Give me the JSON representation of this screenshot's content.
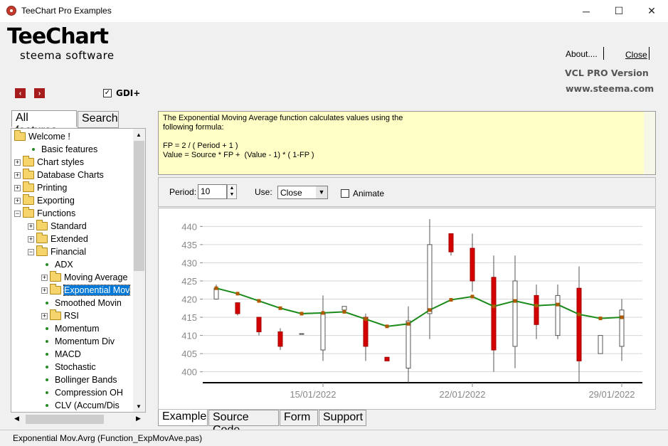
{
  "window": {
    "title": "TeeChart Pro Examples",
    "minimize": "─",
    "maximize": "☐",
    "close": "✕"
  },
  "header": {
    "logo": "TeeChart",
    "logo_sub": "steema software",
    "about": "About....",
    "close_link": "Close",
    "version": "VCL PRO Version",
    "website": "www.steema.com"
  },
  "nav": {
    "back": "‹",
    "forward": "›",
    "gdi_check": "✓",
    "gdi_label": "GDI+"
  },
  "tabs": {
    "all_features": "All features",
    "search": "Search"
  },
  "tree": [
    {
      "label": "Welcome !",
      "type": "folder-open",
      "level": 0
    },
    {
      "label": "Basic features",
      "type": "leaf",
      "level": 1
    },
    {
      "label": "Chart styles",
      "type": "folder",
      "level": 0
    },
    {
      "label": "Database Charts",
      "type": "folder",
      "level": 0
    },
    {
      "label": "Printing",
      "type": "folder",
      "level": 0
    },
    {
      "label": "Exporting",
      "type": "folder",
      "level": 0
    },
    {
      "label": "Functions",
      "type": "folder-open",
      "level": 0
    },
    {
      "label": "Standard",
      "type": "folder",
      "level": 1
    },
    {
      "label": "Extended",
      "type": "folder",
      "level": 1
    },
    {
      "label": "Financial",
      "type": "folder-open",
      "level": 1
    },
    {
      "label": "ADX",
      "type": "leaf",
      "level": 2
    },
    {
      "label": "Moving Average",
      "type": "folder",
      "level": 2
    },
    {
      "label": "Exponential Mov",
      "type": "folder",
      "level": 2,
      "selected": true
    },
    {
      "label": "Smoothed Movin",
      "type": "leaf",
      "level": 2
    },
    {
      "label": "RSI",
      "type": "folder",
      "level": 2
    },
    {
      "label": "Momentum",
      "type": "leaf",
      "level": 2
    },
    {
      "label": "Momentum Div",
      "type": "leaf",
      "level": 2
    },
    {
      "label": "MACD",
      "type": "leaf",
      "level": 2
    },
    {
      "label": "Stochastic",
      "type": "leaf",
      "level": 2
    },
    {
      "label": "Bollinger Bands",
      "type": "leaf",
      "level": 2
    },
    {
      "label": "Compression OH",
      "type": "leaf",
      "level": 2
    },
    {
      "label": "CLV (Accum/Dis",
      "type": "leaf",
      "level": 2
    }
  ],
  "description": "The Exponential Moving Average function calculates values using the\nfollowing formula:\n\nFP = 2 / ( Period + 1 )\nValue = Source * FP +  (Value - 1) * ( 1-FP )",
  "controls": {
    "period_label": "Period:",
    "period_value": "10",
    "use_label": "Use:",
    "use_value": "Close",
    "animate_label": "Animate"
  },
  "bottom_tabs": [
    "Example",
    "Source Code",
    "Form",
    "Support"
  ],
  "status": "Exponential Mov.Avrg (Function_ExpMovAve.pas)",
  "colors": {
    "up": "#ffffff",
    "down": "#d40000",
    "ema": "#1a8a1a",
    "marker": "#b05a00"
  },
  "chart_data": {
    "type": "candlestick",
    "ylim": [
      397,
      443
    ],
    "yticks": [
      400,
      405,
      410,
      415,
      420,
      425,
      430,
      435,
      440
    ],
    "xticks": [
      "15/01/2022",
      "22/01/2022",
      "29/01/2022"
    ],
    "xtick_index": [
      5,
      12,
      19
    ],
    "candles": [
      {
        "o": 420,
        "c": 423,
        "h": 424,
        "l": 420
      },
      {
        "o": 419,
        "c": 416,
        "h": 419,
        "l": 415.5
      },
      {
        "o": 415,
        "c": 411,
        "h": 415,
        "l": 410
      },
      {
        "o": 411,
        "c": 407,
        "h": 412,
        "l": 406
      },
      {
        "o": 410.5,
        "c": 410.5,
        "h": 410.5,
        "l": 410.5
      },
      {
        "o": 406,
        "c": 416,
        "h": 421,
        "l": 403
      },
      {
        "o": 417,
        "c": 418,
        "h": 418,
        "l": 417
      },
      {
        "o": 415,
        "c": 407,
        "h": 416,
        "l": 403
      },
      {
        "o": 404,
        "c": 403,
        "h": 404,
        "l": 403
      },
      {
        "o": 401,
        "c": 414,
        "h": 418,
        "l": 397
      },
      {
        "o": 416,
        "c": 435,
        "h": 442,
        "l": 409
      },
      {
        "o": 438,
        "c": 433,
        "h": 438,
        "l": 432
      },
      {
        "o": 434,
        "c": 425,
        "h": 438,
        "l": 422
      },
      {
        "o": 426,
        "c": 406,
        "h": 432,
        "l": 400
      },
      {
        "o": 407,
        "c": 425,
        "h": 432,
        "l": 401
      },
      {
        "o": 421,
        "c": 413,
        "h": 424,
        "l": 409
      },
      {
        "o": 410,
        "c": 421,
        "h": 424,
        "l": 409
      },
      {
        "o": 423,
        "c": 403,
        "h": 429,
        "l": 397
      },
      {
        "o": 405,
        "c": 410,
        "h": 410,
        "l": 405
      },
      {
        "o": 407,
        "c": 417,
        "h": 420,
        "l": 403
      }
    ],
    "ema": [
      423,
      421.5,
      419.5,
      417.5,
      416,
      416.2,
      416.5,
      414.5,
      412.5,
      413.2,
      417,
      419.8,
      420.7,
      418,
      419.5,
      418.2,
      418.5,
      415.8,
      414.7,
      415
    ]
  }
}
